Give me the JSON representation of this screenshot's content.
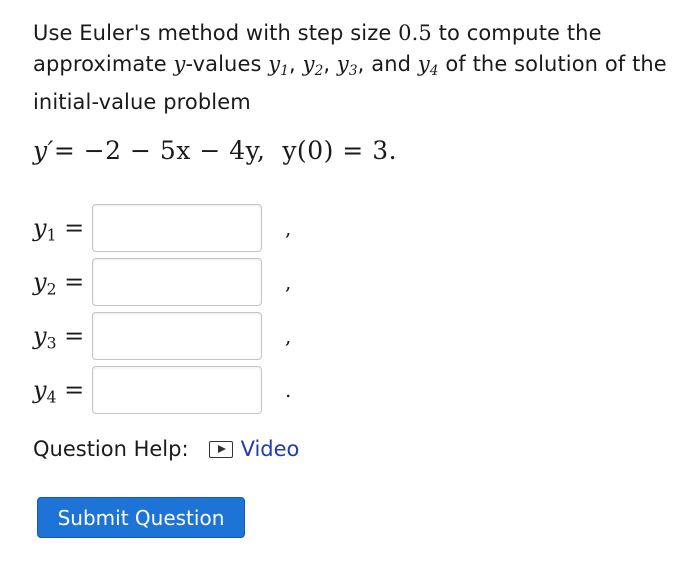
{
  "question": {
    "intro": "Use Euler's method with step size",
    "step_size": "0.5",
    "intro2": "to compute the approximate",
    "y_symbol": "y",
    "intro3": "-values",
    "var_list": [
      "y1",
      "y2",
      "y3"
    ],
    "and_text": "and",
    "last_var": "y4",
    "intro4": "of the solution of the initial-value problem"
  },
  "equation": {
    "lhs": "y′",
    "rhs": "= −2 − 5x − 4y,",
    "initial": "y(0) = 3."
  },
  "answers": [
    {
      "label": "y",
      "sub": "1",
      "equals": "=",
      "value": "",
      "punct": ","
    },
    {
      "label": "y",
      "sub": "2",
      "equals": "=",
      "value": "",
      "punct": ","
    },
    {
      "label": "y",
      "sub": "3",
      "equals": "=",
      "value": "",
      "punct": ","
    },
    {
      "label": "y",
      "sub": "4",
      "equals": "=",
      "value": "",
      "punct": "."
    }
  ],
  "help": {
    "label": "Question Help:",
    "icon": "play-icon",
    "video_label": "Video"
  },
  "submit_label": "Submit Question"
}
